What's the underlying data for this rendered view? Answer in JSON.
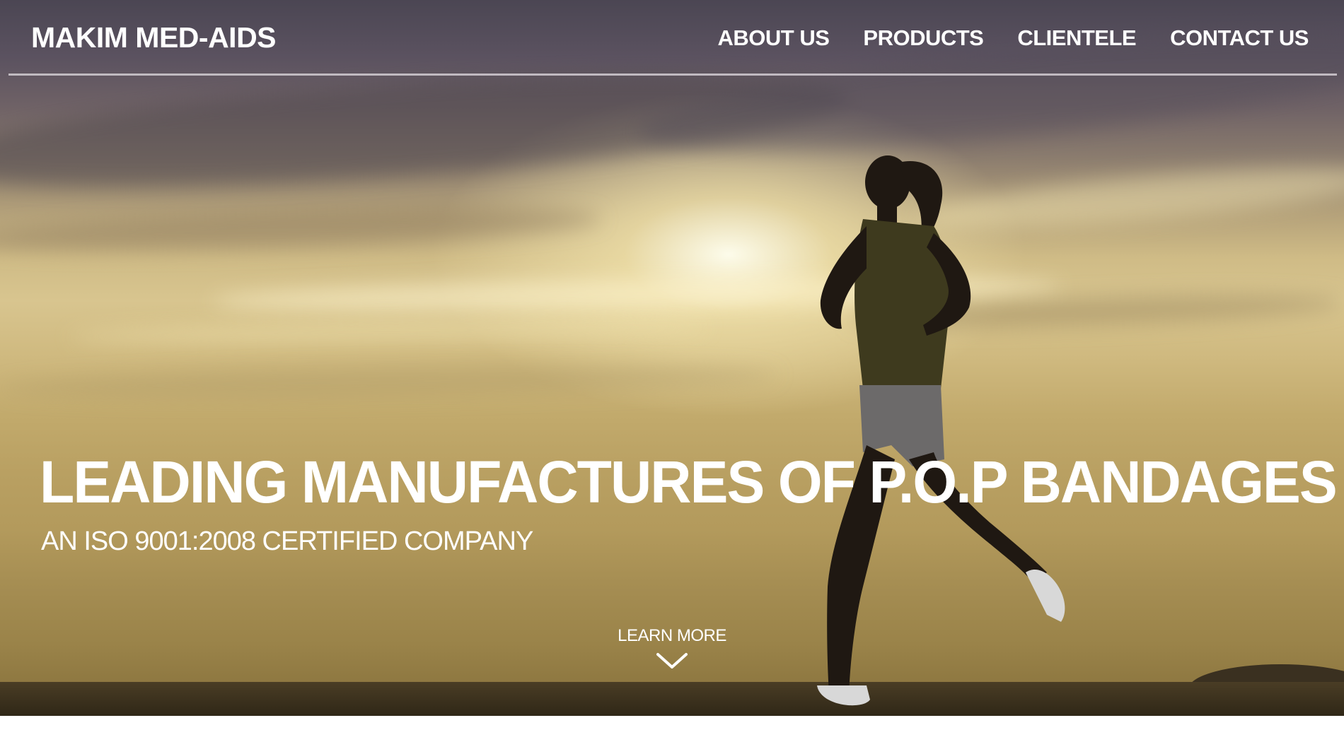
{
  "header": {
    "logo": "MAKIM MED-AIDS",
    "nav": [
      {
        "label": "ABOUT US"
      },
      {
        "label": "PRODUCTS"
      },
      {
        "label": "CLIENTELE"
      },
      {
        "label": "CONTACT US"
      }
    ]
  },
  "hero": {
    "headline": "LEADING MANUFACTURES OF P.O.P BANDAGES",
    "subheadline": "AN ISO 9001:2008 CERTIFIED COMPANY",
    "cta_label": "LEARN MORE",
    "cta_icon": "chevron-down-icon",
    "background_image": "sunset-runner-photo"
  },
  "colors": {
    "text": "#ffffff",
    "sky_top": "#4b4653",
    "sky_mid": "#d8c58f",
    "ground": "#2e2616"
  }
}
